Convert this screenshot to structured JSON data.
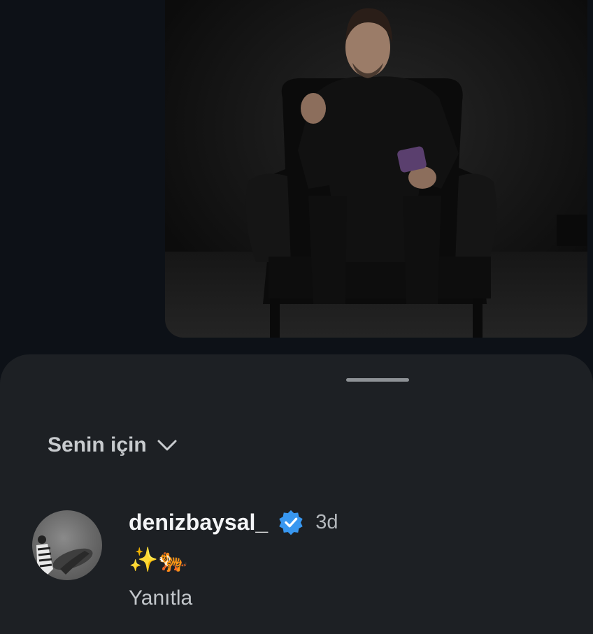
{
  "feed": {
    "media_alt": "Video frame: man in black suit seated in a black leather armchair"
  },
  "comments_sheet": {
    "filter_label": "Senin için",
    "filter_icon": "chevron-down-icon",
    "comment": {
      "username": "denizbaysal_",
      "verified_icon": "verified-badge-icon",
      "verified_color": "#3897f0",
      "time_ago": "3d",
      "text": "✨🐅",
      "reply_label": "Yanıtla"
    }
  }
}
